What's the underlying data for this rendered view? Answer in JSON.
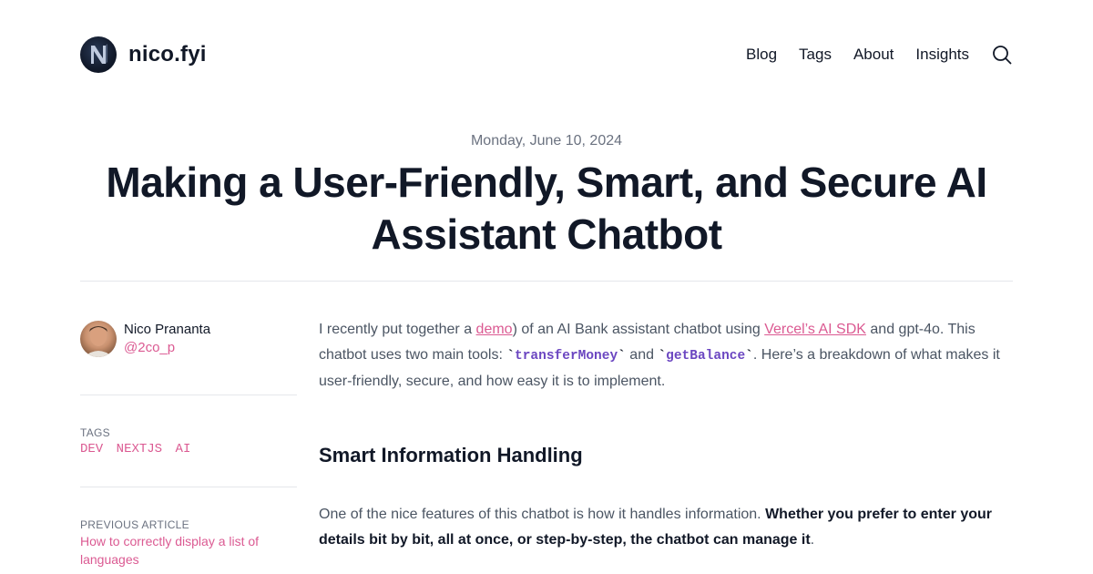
{
  "header": {
    "site_name": "nico.fyi",
    "logo_letter": "N",
    "nav": [
      "Blog",
      "Tags",
      "About",
      "Insights"
    ],
    "search_icon": "search-icon"
  },
  "article": {
    "date": "Monday, June 10, 2024",
    "title": "Making a User-Friendly, Smart, and Secure AI Assistant Chatbot"
  },
  "sidebar": {
    "author_name": "Nico Prananta",
    "author_handle": "@2co_p",
    "tags_label": "TAGS",
    "tags": [
      "DEV",
      "NEXTJS",
      "AI"
    ],
    "previous_label": "PREVIOUS ARTICLE",
    "previous_title": "How to correctly display a list of languages"
  },
  "content": {
    "p1_a": "I recently put together a ",
    "p1_link1": "demo",
    "p1_b": ") of an AI Bank assistant chatbot using ",
    "p1_link2": "Vercel’s AI SDK",
    "p1_c": " and gpt-4o. This chatbot uses two main tools: ",
    "code1": "transferMoney",
    "p1_d": " and ",
    "code2": "getBalance",
    "p1_e": ". Here’s a breakdown of what makes it user-friendly, secure, and how easy it is to implement.",
    "heading": "Smart Information Handling",
    "p2_a": "One of the nice features of this chatbot is how it handles information. ",
    "p2_strong": "Whether you prefer to enter your details bit by bit, all at once, or step-by-step, the chatbot can manage it",
    "p2_b": "."
  },
  "colors": {
    "accent": "#db5a92",
    "text": "#111827",
    "muted": "#6b7280",
    "code": "#6b46c1"
  }
}
